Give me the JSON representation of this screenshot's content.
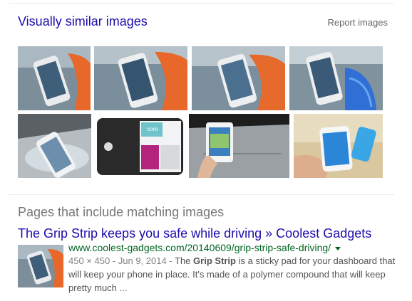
{
  "similar": {
    "title": "Visually similar images",
    "report_label": "Report images",
    "thumbnails": [
      {
        "icon": "phone-on-orange-grip-image"
      },
      {
        "icon": "phone-on-orange-grip-image"
      },
      {
        "icon": "phone-on-orange-grip-image"
      },
      {
        "icon": "phone-on-blue-grip-image"
      },
      {
        "icon": "phone-on-clear-pad-image"
      },
      {
        "icon": "core-package-image"
      },
      {
        "icon": "phone-on-dashboard-image"
      },
      {
        "icon": "phone-in-hand-image"
      }
    ]
  },
  "pages": {
    "heading": "Pages that include matching images",
    "results": [
      {
        "title": "The Grip Strip keeps you safe while driving » Coolest Gadgets",
        "url": "www.coolest-gadgets.com/20140609/grip-strip-safe-driving/",
        "meta": "450 × 450 - Jun 9, 2014 - ",
        "snippet_pre": "The ",
        "snippet_bold1": "Grip Strip",
        "snippet_mid": " is a sticky pad for your dashboard that will keep your phone in place. It's made of a polymer compound that will keep pretty much ...",
        "thumb_icon": "phone-on-orange-grip-image"
      }
    ]
  },
  "colors": {
    "link": "#1a0dab",
    "url": "#006621",
    "heading_gray": "#777777",
    "grip_orange": "#e8672a",
    "grip_blue": "#2f6fd6"
  }
}
